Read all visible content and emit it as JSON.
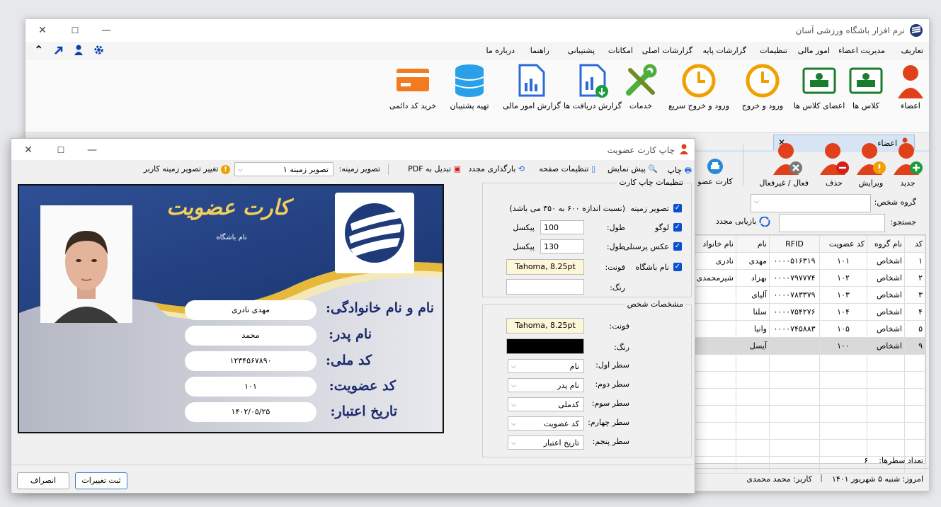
{
  "main": {
    "title": "نرم افزار باشگاه ورزشی آسان",
    "menu": [
      "تعاریف",
      "مدیریت اعضاء",
      "امور مالی",
      "تنظیمات",
      "گزارشات پایه",
      "گزارشات اصلی",
      "امکانات",
      "پشتیبانی",
      "راهنما",
      "درباره ما"
    ],
    "ribbon": [
      "اعضاء",
      "کلاس ها",
      "اعضای کلاس ها",
      "ورود و خروج",
      "ورود و خروج سریع",
      "خدمات",
      "گزارش دریافت ها",
      "گزارش امور مالی",
      "تهیه پشتیبان",
      "خرید کد دائمی"
    ],
    "tab_label": "اعضاء",
    "toolbar": [
      "جدید",
      "ویرایش",
      "حذف",
      "فعال / غیرفعال",
      "کارت عضو"
    ],
    "group_label": "گروه شخص:",
    "search_label": "جستجو:",
    "reload_label": "بازیابی مجدد",
    "columns": [
      "کد",
      "نام گروه",
      "کد عضویت",
      "RFID",
      "نام",
      "نام خانواد"
    ],
    "rows": [
      [
        "۱",
        "اشخاص",
        "۱۰۱",
        "۰۰۰۰۵۱۶۳۱۹",
        "مهدی",
        "نادری"
      ],
      [
        "۲",
        "اشخاص",
        "۱۰۲",
        "۰۰۰۰۷۹۷۷۷۴",
        "بهزاد",
        "شیرمحمدی"
      ],
      [
        "۳",
        "اشخاص",
        "۱۰۳",
        "۰۰۰۰۷۸۳۳۷۹",
        "آلیای",
        ""
      ],
      [
        "۴",
        "اشخاص",
        "۱۰۴",
        "۰۰۰۰۷۵۴۲۷۶",
        "سلنا",
        ""
      ],
      [
        "۵",
        "اشخاص",
        "۱۰۵",
        "۰۰۰۰۷۴۵۸۸۳",
        "وانیا",
        ""
      ],
      [
        "۹",
        "اشخاص",
        "۱۰۰",
        "",
        "آیسل",
        ""
      ]
    ],
    "row_count_label": "تعداد سطرها:",
    "row_count": "۶",
    "status_date": "امروز: شنبه ۵ شهریور ۱۴۰۱",
    "status_user": "کاربر: محمد محمدی"
  },
  "dialog": {
    "title": "چاپ کارت عضویت",
    "tools": {
      "print": "چاپ",
      "preview": "پیش نمایش",
      "page_settings": "تنظیمات صفحه",
      "reload": "بارگذاری مجدد",
      "pdf": "تبدیل به PDF",
      "bg_label": "تصویر زمینه:",
      "bg_value": "تصویر زمینه ۱",
      "change_bg": "تغییر تصویر زمینه کاربر"
    },
    "settings": {
      "group_title": "تنظیمات چاپ کارت",
      "bg_image": "تصویر زمینه",
      "bg_note": "(نسبت اندازه ۶۰۰ به ۳۵۰ می باشد)",
      "logo": "لوگو",
      "personal_photo": "عکس پرسنلی",
      "club_name": "نام باشگاه",
      "length_label": "طول:",
      "logo_length": "100",
      "photo_length": "130",
      "pixel": "پیکسل",
      "font_label": "فونت:",
      "font_value": "Tahoma, 8.25pt",
      "color_label": "رنگ:",
      "person_group_title": "مشخصات شخص",
      "person_font": "Tahoma, 8.25pt",
      "lines": [
        {
          "label": "سطر اول:",
          "value": "نام"
        },
        {
          "label": "سطر دوم:",
          "value": "نام پدر"
        },
        {
          "label": "سطر سوم:",
          "value": "کدملی"
        },
        {
          "label": "سطر چهارم:",
          "value": "کد عضویت"
        },
        {
          "label": "سطر پنجم:",
          "value": "تاریخ اعتبار"
        }
      ]
    },
    "card": {
      "title": "کارت عضویت",
      "club_name": "نام باشگاه",
      "fields": [
        {
          "label": "نام و نام خانوادگی:",
          "value": "مهدی نادری"
        },
        {
          "label": "نام پدر:",
          "value": "محمد"
        },
        {
          "label": "کد ملی:",
          "value": "۱۲۳۴۵۶۷۸۹۰"
        },
        {
          "label": "کد عضویت:",
          "value": "۱۰۱"
        },
        {
          "label": "تاریخ اعتبار:",
          "value": "۱۴۰۲/۰۵/۲۵"
        }
      ]
    },
    "save_button": "ثبت تغییرات",
    "cancel_button": "انصراف"
  },
  "colors": {
    "accent": "#0a4fd0",
    "person_red": "#e0401a",
    "card_navy": "#1e3a78",
    "card_gold": "#e6b93a"
  }
}
